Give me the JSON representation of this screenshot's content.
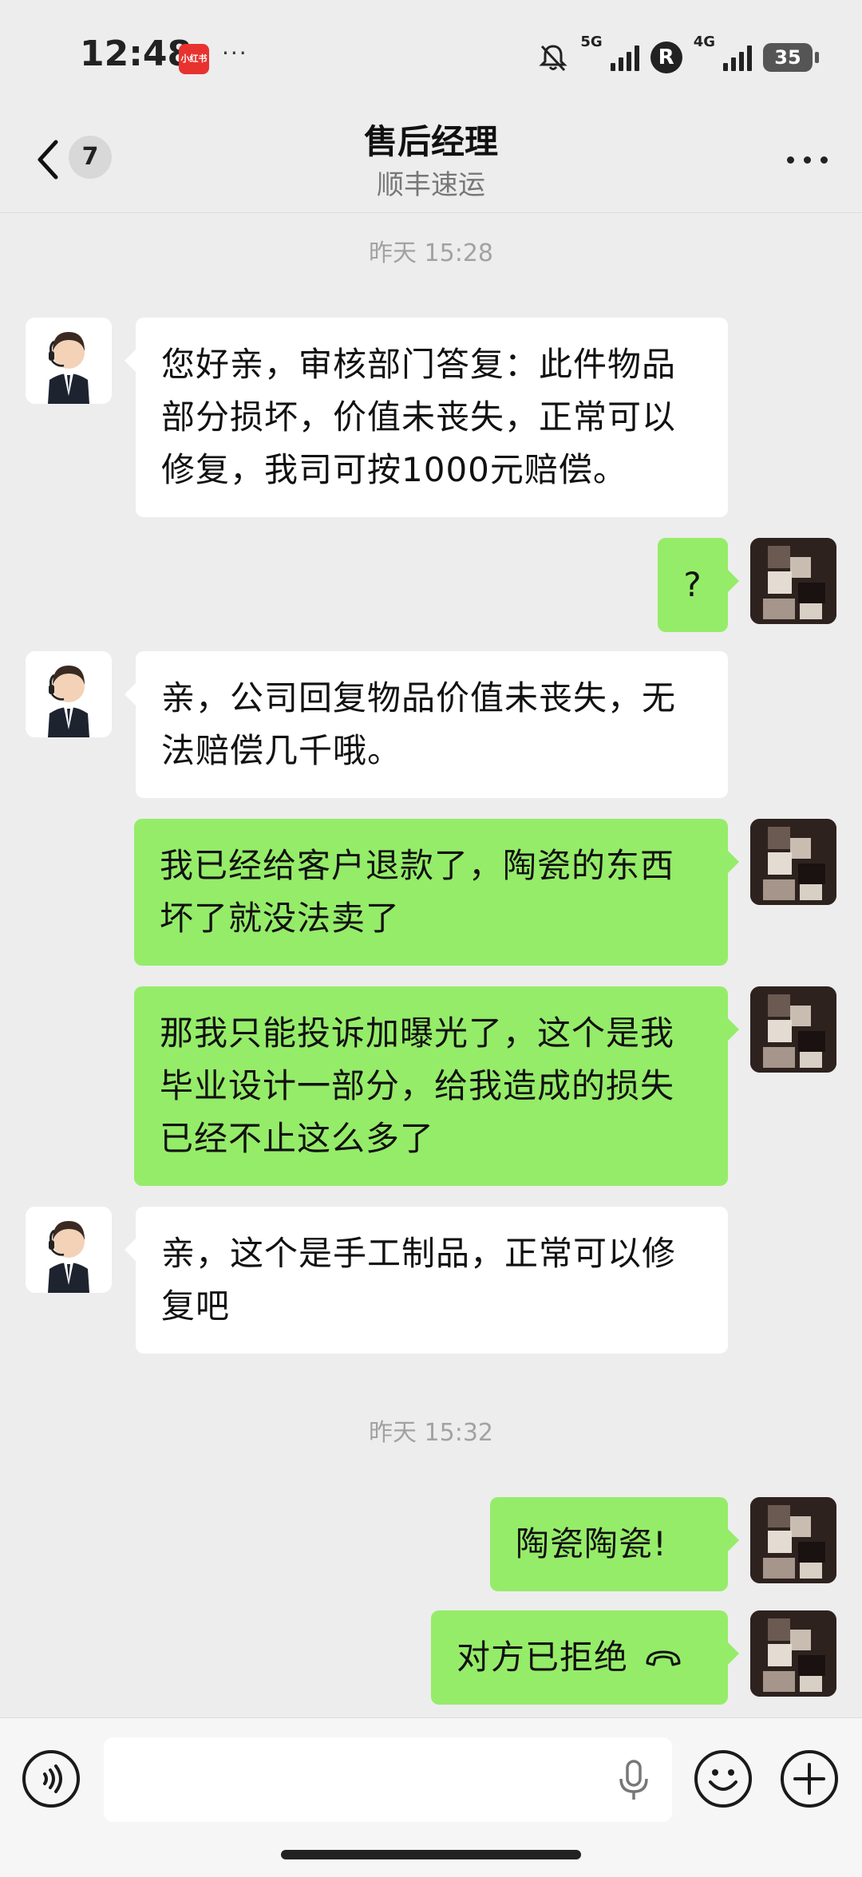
{
  "status_bar": {
    "time": "12:48",
    "app_badge": "小红书",
    "more_dots": "···",
    "net1": "5G",
    "net2": "4G",
    "r_label": "R",
    "battery": "35"
  },
  "header": {
    "back_count": "7",
    "title": "售后经理",
    "subtitle": "顺丰速运"
  },
  "timestamps": [
    "昨天 15:28",
    "昨天 15:32"
  ],
  "messages": [
    {
      "from": "agent",
      "text": "您好亲，审核部门答复：此件物品部分损坏，价值未丧失，正常可以修复，我司可按1000元赔偿。"
    },
    {
      "from": "me",
      "text": "?"
    },
    {
      "from": "agent",
      "text": "亲，公司回复物品价值未丧失，无法赔偿几千哦。"
    },
    {
      "from": "me",
      "text": "我已经给客户退款了，陶瓷的东西坏了就没法卖了"
    },
    {
      "from": "me",
      "text": "那我只能投诉加曝光了，这个是我毕业设计一部分，给我造成的损失已经不止这么多了"
    },
    {
      "from": "agent",
      "text": "亲，这个是手工制品，正常可以修复吧"
    },
    {
      "from": "me",
      "text": "陶瓷陶瓷!"
    },
    {
      "from": "me",
      "text": "对方已拒绝"
    }
  ],
  "colors": {
    "background": "#ededed",
    "incoming": "#ffffff",
    "outgoing": "#95ec69"
  },
  "icons": [
    "chevron-left-icon",
    "more-icon",
    "voice-icon",
    "microphone-icon",
    "emoji-icon",
    "plus-icon",
    "call-declined-icon"
  ]
}
